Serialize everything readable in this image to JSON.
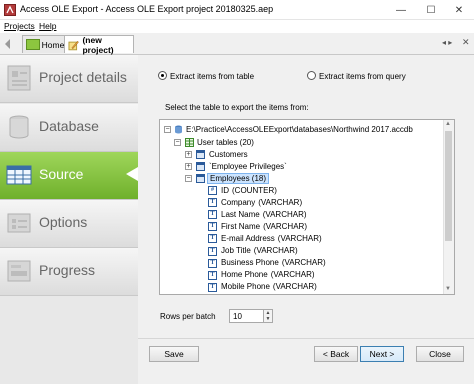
{
  "window": {
    "title": "Access OLE Export - Access OLE Export project 20180325.aep",
    "minimize": "—",
    "maximize": "☐",
    "close": "✕"
  },
  "menu": [
    "Projects",
    "Help"
  ],
  "tabs": [
    {
      "label": "Home"
    },
    {
      "label": "(new project)"
    }
  ],
  "nav": {
    "items": [
      {
        "label": "Project details",
        "icon": "project-details-icon"
      },
      {
        "label": "Database",
        "icon": "database-icon"
      },
      {
        "label": "Source",
        "icon": "source-icon",
        "active": true
      },
      {
        "label": "Options",
        "icon": "options-icon"
      },
      {
        "label": "Progress",
        "icon": "progress-icon"
      }
    ]
  },
  "source": {
    "radio_table": "Extract items from table",
    "radio_query": "Extract items from query",
    "instruction": "Select the table to export the items from:",
    "tree": {
      "db_path": "E:\\Practice\\AccessOLEExport\\databases\\Northwind 2017.accdb",
      "user_tables": "User tables (20)",
      "tables": [
        "Customers",
        "`Employee Privileges`"
      ],
      "selected_table": "Employees (18)",
      "fields": [
        {
          "name": "ID",
          "type": "(COUNTER)",
          "icon": "#"
        },
        {
          "name": "Company",
          "type": "(VARCHAR)",
          "icon": "T"
        },
        {
          "name": "Last Name",
          "type": "(VARCHAR)",
          "icon": "T"
        },
        {
          "name": "First Name",
          "type": "(VARCHAR)",
          "icon": "T"
        },
        {
          "name": "E-mail Address",
          "type": "(VARCHAR)",
          "icon": "T"
        },
        {
          "name": "Job Title",
          "type": "(VARCHAR)",
          "icon": "T"
        },
        {
          "name": "Business Phone",
          "type": "(VARCHAR)",
          "icon": "T"
        },
        {
          "name": "Home Phone",
          "type": "(VARCHAR)",
          "icon": "T"
        },
        {
          "name": "Mobile Phone",
          "type": "(VARCHAR)",
          "icon": "T"
        }
      ]
    },
    "rows_label": "Rows per batch",
    "rows_value": "10"
  },
  "buttons": {
    "save": "Save",
    "back": "< Back",
    "next": "Next >",
    "close": "Close"
  },
  "colors": {
    "nav_active": "#8cc63f",
    "selection": "#cce4ff"
  }
}
